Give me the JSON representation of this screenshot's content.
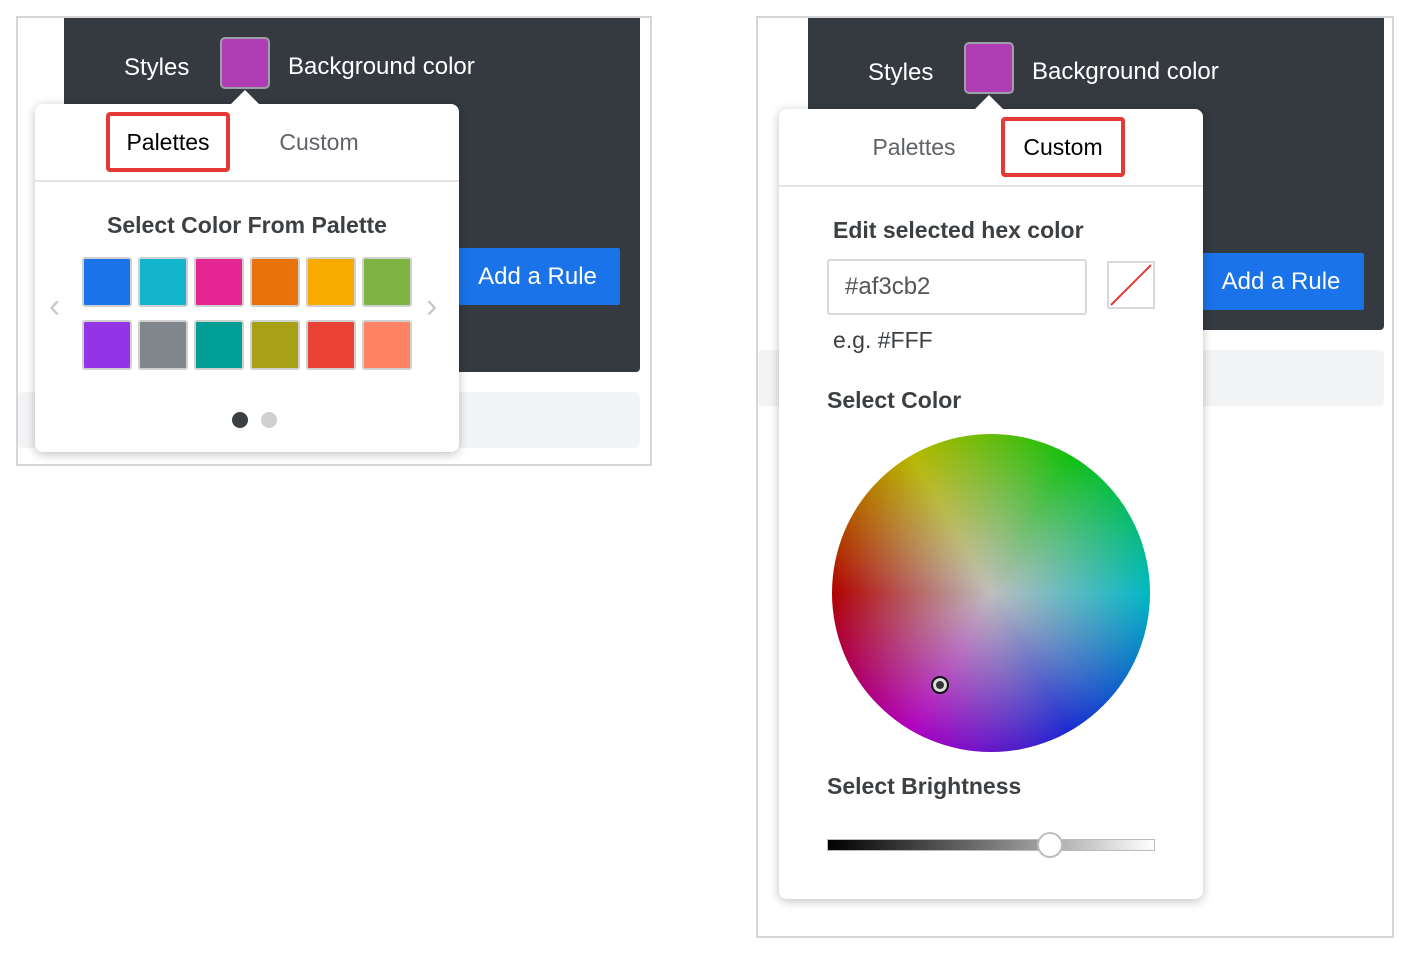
{
  "colors": {
    "accent": "#1a73e8",
    "header_bg": "#343a40",
    "selected_color": "#af3cb2",
    "highlight": "#e53935"
  },
  "left": {
    "styles_label": "Styles",
    "bg_color_label": "Background color",
    "add_rule_label": "Add a Rule",
    "tabs": {
      "palettes": "Palettes",
      "custom": "Custom",
      "active": "palettes"
    },
    "palette_heading": "Select Color From Palette",
    "palette_colors": [
      [
        "#1a73e8",
        "#12b5cb",
        "#e52592",
        "#e8710a",
        "#f9ab00",
        "#7cb342"
      ],
      [
        "#9334e6",
        "#80868b",
        "#009e95",
        "#a8a117",
        "#ea4335",
        "#ff8264"
      ]
    ],
    "pages": {
      "count": 2,
      "current": 1
    },
    "prev_icon": "chevron-left-icon",
    "next_icon": "chevron-right-icon"
  },
  "right": {
    "styles_label": "Styles",
    "bg_color_label": "Background color",
    "add_rule_label": "Add a Rule",
    "tabs": {
      "palettes": "Palettes",
      "custom": "Custom",
      "active": "custom"
    },
    "hex_heading": "Edit selected hex color",
    "hex_value": "#af3cb2",
    "hex_hint": "e.g. #FFF",
    "no_color_icon": "no-color-icon",
    "select_color_heading": "Select Color",
    "select_brightness_heading": "Select Brightness",
    "brightness": 0.68
  }
}
